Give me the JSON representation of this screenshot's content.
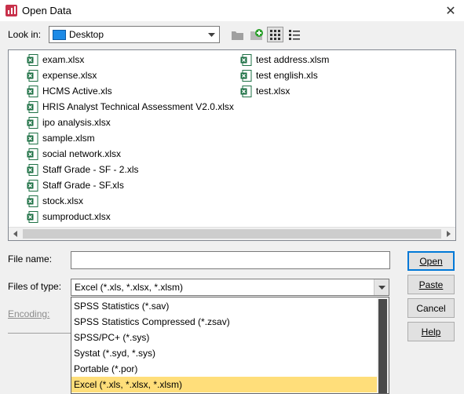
{
  "window": {
    "title": "Open Data",
    "close_glyph": "✕"
  },
  "look_in": {
    "label": "Look in:",
    "value": "Desktop",
    "icon": "desktop-icon"
  },
  "toolbar": {
    "buttons": [
      {
        "name": "up-folder-button",
        "icon": "folder-up-icon"
      },
      {
        "name": "new-folder-button",
        "icon": "new-folder-icon"
      },
      {
        "name": "list-view-button",
        "icon": "list-view-icon"
      },
      {
        "name": "details-view-button",
        "icon": "details-view-icon"
      }
    ]
  },
  "files": {
    "column1": [
      {
        "name": "exam.xlsx",
        "icon": "excel-file-icon"
      },
      {
        "name": "expense.xlsx",
        "icon": "excel-file-icon"
      },
      {
        "name": "HCMS Active.xls",
        "icon": "excel-file-icon"
      },
      {
        "name": "HRIS Analyst Technical Assessment V2.0.xlsx",
        "icon": "excel-file-icon"
      },
      {
        "name": "ipo analysis.xlsx",
        "icon": "excel-file-icon"
      },
      {
        "name": "sample.xlsm",
        "icon": "excel-file-icon"
      },
      {
        "name": "social network.xlsx",
        "icon": "excel-file-icon"
      },
      {
        "name": "Staff Grade - SF - 2.xls",
        "icon": "excel-file-icon"
      },
      {
        "name": "Staff Grade - SF.xls",
        "icon": "excel-file-icon"
      },
      {
        "name": "stock.xlsx",
        "icon": "excel-file-icon"
      },
      {
        "name": "sumproduct.xlsx",
        "icon": "excel-file-icon"
      }
    ],
    "column2": [
      {
        "name": "test address.xlsm",
        "icon": "excel-file-icon"
      },
      {
        "name": "test english.xls",
        "icon": "excel-file-icon"
      },
      {
        "name": "test.xlsx",
        "icon": "excel-file-icon"
      }
    ]
  },
  "file_name": {
    "label": "File name:",
    "value": ""
  },
  "files_of_type": {
    "label": "Files of type:",
    "value": "Excel (*.xls, *.xlsx, *.xlsm)",
    "options": [
      "SPSS Statistics (*.sav)",
      "SPSS Statistics Compressed (*.zsav)",
      "SPSS/PC+ (*.sys)",
      "Systat (*.syd, *.sys)",
      "Portable (*.por)",
      "Excel (*.xls, *.xlsx, *.xlsm)"
    ],
    "selected_index": 5
  },
  "encoding": {
    "label": "Encoding:",
    "value": ""
  },
  "buttons": {
    "open": "Open",
    "paste": "Paste",
    "cancel": "Cancel",
    "help": "Help"
  },
  "colors": {
    "accent": "#0078d7",
    "selection": "#ffde7a",
    "excel_green": "#1e7145"
  }
}
